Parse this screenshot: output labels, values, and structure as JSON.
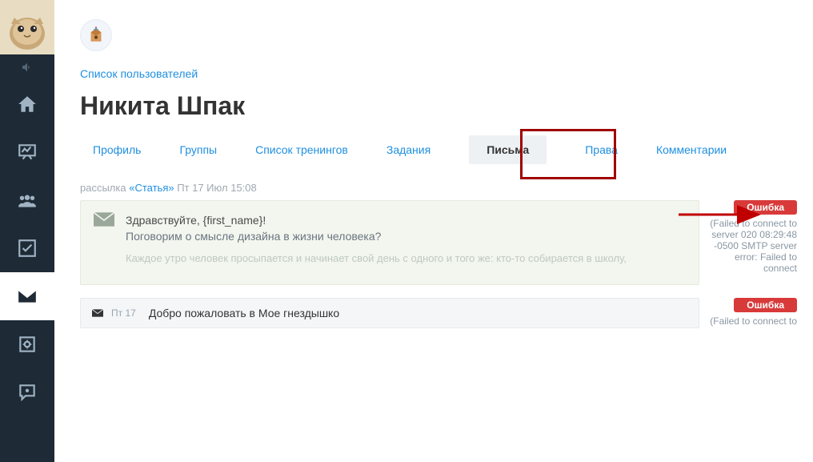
{
  "breadcrumb": "Список пользователей",
  "page_title": "Никита Шпак",
  "tabs": [
    {
      "label": "Профиль"
    },
    {
      "label": "Группы"
    },
    {
      "label": "Список тренингов"
    },
    {
      "label": "Задания"
    },
    {
      "label": "Письма",
      "active": true
    },
    {
      "label": "Права"
    },
    {
      "label": "Комментарии"
    }
  ],
  "meta": {
    "prefix": "рассылка ",
    "link": "«Статья»",
    "timestamp": " Пт 17 Июл 15:08"
  },
  "letter1": {
    "subject": "Здравствуйте, {first_name}!",
    "question": "Поговорим о смысле дизайна в жизни человека?",
    "body": "Каждое утро человек просыпается и начинает свой день с одного и того же: кто-то собирается в школу,"
  },
  "letter2": {
    "date": "Пт 17",
    "subject": "Добро пожаловать в Мое гнездышко"
  },
  "status1": {
    "badge": "Ошибка",
    "text": "(Failed to connect to server 020 08:29:48 -0500 SMTP server error: Failed to connect"
  },
  "status2": {
    "badge": "Ошибка",
    "text": "(Failed to connect to"
  }
}
